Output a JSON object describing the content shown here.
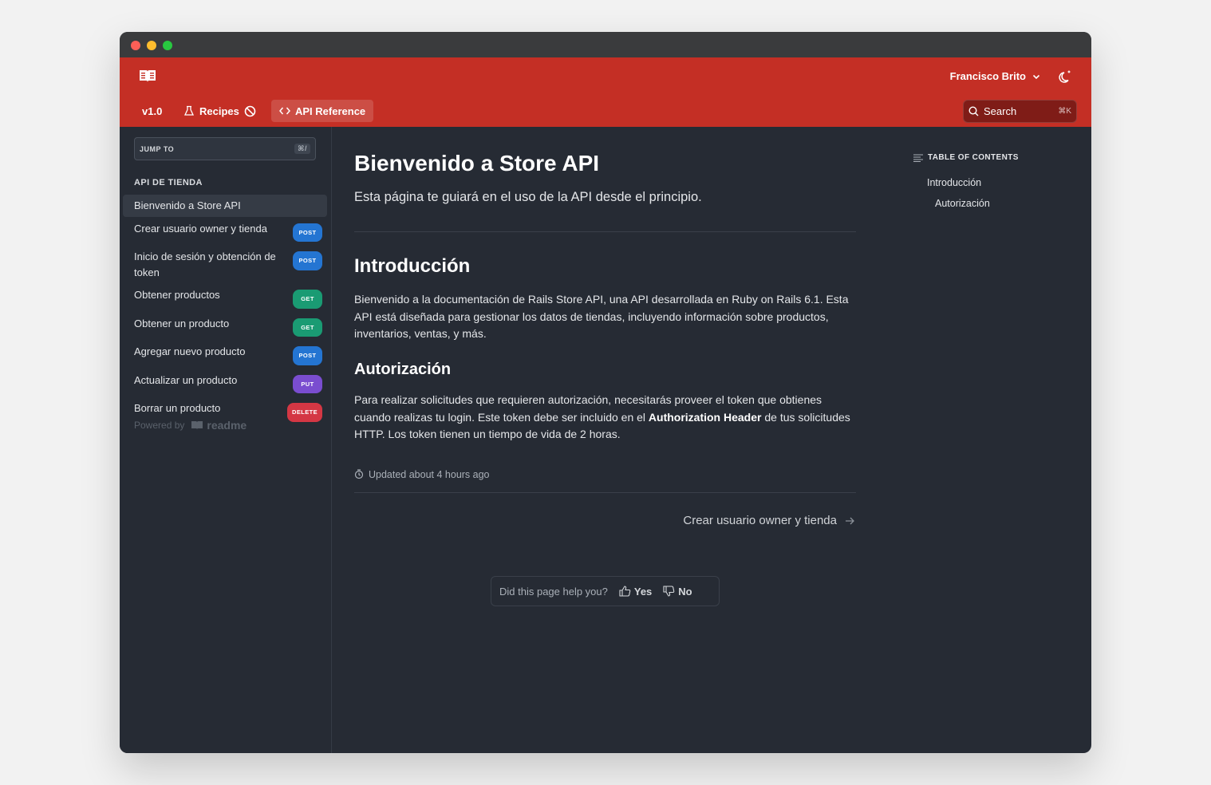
{
  "header": {
    "user_name": "Francisco Brito",
    "nav": {
      "version": "v1.0",
      "recipes": "Recipes",
      "api_reference": "API Reference"
    },
    "search": {
      "label": "Search",
      "shortcut": "⌘K"
    }
  },
  "sidebar": {
    "jump_to": "JUMP TO",
    "jump_shortcut": "⌘/",
    "section_title": "API DE TIENDA",
    "items": [
      {
        "label": "Bienvenido a Store API",
        "method": ""
      },
      {
        "label": "Crear usuario owner y tienda",
        "method": "POST"
      },
      {
        "label": "Inicio de sesión y obtención de token",
        "method": "POST"
      },
      {
        "label": "Obtener productos",
        "method": "GET"
      },
      {
        "label": "Obtener un producto",
        "method": "GET"
      },
      {
        "label": "Agregar nuevo producto",
        "method": "POST"
      },
      {
        "label": "Actualizar un producto",
        "method": "PUT"
      },
      {
        "label": "Borrar un producto",
        "method": "DELETE"
      }
    ],
    "powered_by": "Powered by",
    "brand": "readme"
  },
  "main": {
    "title": "Bienvenido a Store API",
    "subtitle": "Esta página te guiará en el uso de la API desde el principio.",
    "intro_heading": "Introducción",
    "intro_text": "Bienvenido a la documentación de Rails Store API, una API desarrollada en Ruby on Rails 6.1. Esta API está diseñada para gestionar los datos de tiendas, incluyendo información sobre productos, inventarios, ventas, y más.",
    "auth_heading": "Autorización",
    "auth_text_1": "Para realizar solicitudes que requieren autorización, necesitarás proveer el token que obtienes cuando realizas tu login. Este token debe ser incluido en el ",
    "auth_text_bold": "Authorization Header",
    "auth_text_2": " de tus solicitudes HTTP. Los token tienen un tiempo de vida de 2 horas.",
    "updated": "Updated about 4 hours ago",
    "next_link": "Crear usuario owner y tienda",
    "feedback": {
      "question": "Did this page help you?",
      "yes": "Yes",
      "no": "No"
    }
  },
  "toc": {
    "title": "TABLE OF CONTENTS",
    "items": [
      "Introducción",
      "Autorización"
    ]
  },
  "colors": {
    "brand": "#c42f25",
    "background": "#262b34",
    "post": "#2475d2",
    "get": "#1a9b73",
    "put": "#7a4dd0",
    "delete": "#d43744"
  }
}
